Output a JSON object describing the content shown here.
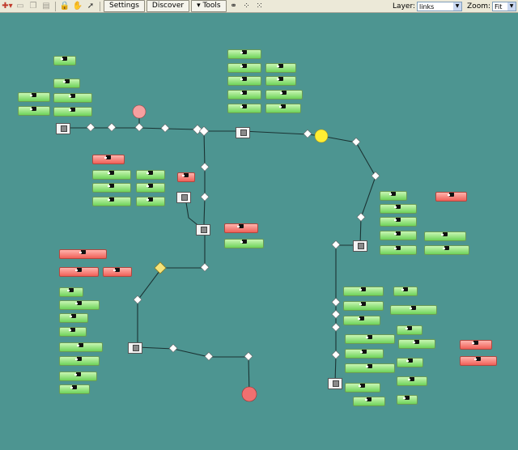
{
  "toolbar": {
    "settings_label": "Settings",
    "discover_label": "Discover",
    "tools_label": "Tools",
    "layer_label": "Layer:",
    "layer_value": "links",
    "zoom_label": "Zoom:",
    "zoom_value": "Fit"
  },
  "colors": {
    "canvas": "#4d9591",
    "device_ok": "#6fd35a",
    "device_alarm": "#f06058",
    "cloud_yellow": "#ffee33",
    "cloud_red": "#f07070"
  }
}
